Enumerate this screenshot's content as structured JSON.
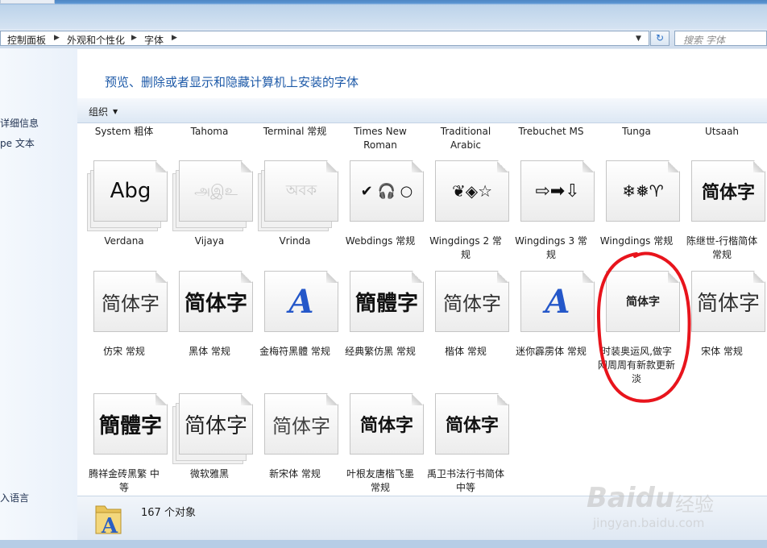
{
  "window": {},
  "address": {
    "crumbs": [
      "控制面板",
      "外观和个性化",
      "字体"
    ]
  },
  "search": {
    "placeholder": "搜索 字体"
  },
  "sidebar": {
    "items": [
      {
        "label": "详细信息"
      },
      {
        "label": "pe 文本"
      },
      {
        "label": "入语言"
      }
    ]
  },
  "page_title": "预览、删除或者显示和隐藏计算机上安装的字体",
  "toolbar": {
    "organize_label": "组织"
  },
  "fonts_top_row": [
    {
      "label": "System 粗体"
    },
    {
      "label": "Tahoma"
    },
    {
      "label": "Terminal 常规"
    },
    {
      "label": "Times New Roman"
    },
    {
      "label": "Traditional Arabic"
    },
    {
      "label": "Trebuchet MS"
    },
    {
      "label": "Tunga"
    },
    {
      "label": "Utsaah"
    }
  ],
  "fonts": [
    {
      "label": "Verdana",
      "sample": "Abg",
      "stack": true
    },
    {
      "label": "Vijaya",
      "sample": "அஇஉ",
      "stack": true,
      "faded": true
    },
    {
      "label": "Vrinda",
      "sample": "অবক",
      "stack": true,
      "faded": true
    },
    {
      "label": "Webdings 常规",
      "sample": "✔ 🎧 ○"
    },
    {
      "label": "Wingdings 2 常规",
      "sample": "❦◈☆"
    },
    {
      "label": "Wingdings 3 常规",
      "sample": "⇨➡⇩"
    },
    {
      "label": "Wingdings 常规",
      "sample": "❄❅♈"
    },
    {
      "label": "陈继世-行楷简体 常规",
      "sample": "简体字"
    },
    {
      "label": "仿宋 常规",
      "sample": "简体字"
    },
    {
      "label": "黑体 常规",
      "sample": "简体字"
    },
    {
      "label": "金梅符黑體 常规",
      "sample": "A"
    },
    {
      "label": "经典繁仿黑 常规",
      "sample": "簡體字"
    },
    {
      "label": "楷体 常规",
      "sample": "简体字"
    },
    {
      "label": "迷你霹雳体 常规",
      "sample": "A"
    },
    {
      "label": "时装奥运风,做字网周周有新款更新 淡",
      "sample": "简体字"
    },
    {
      "label": "宋体 常规",
      "sample": "简体字"
    },
    {
      "label": "腾祥金砖黑繁 中等",
      "sample": "簡體字"
    },
    {
      "label": "微软雅黑",
      "sample": "简体字",
      "stack": true
    },
    {
      "label": "新宋体 常规",
      "sample": "简体字"
    },
    {
      "label": "叶根友唐楷飞墨 常规",
      "sample": "简体字"
    },
    {
      "label": "禹卫书法行书简体 中等",
      "sample": "简体字"
    }
  ],
  "status": {
    "count_text": "167 个对象"
  },
  "watermark": {
    "brand": "Baidu",
    "sub": "经验",
    "url": "jingyan.baidu.com"
  },
  "colors": {
    "title_blue": "#1e5aa8",
    "annotation_red": "#e8141c"
  }
}
